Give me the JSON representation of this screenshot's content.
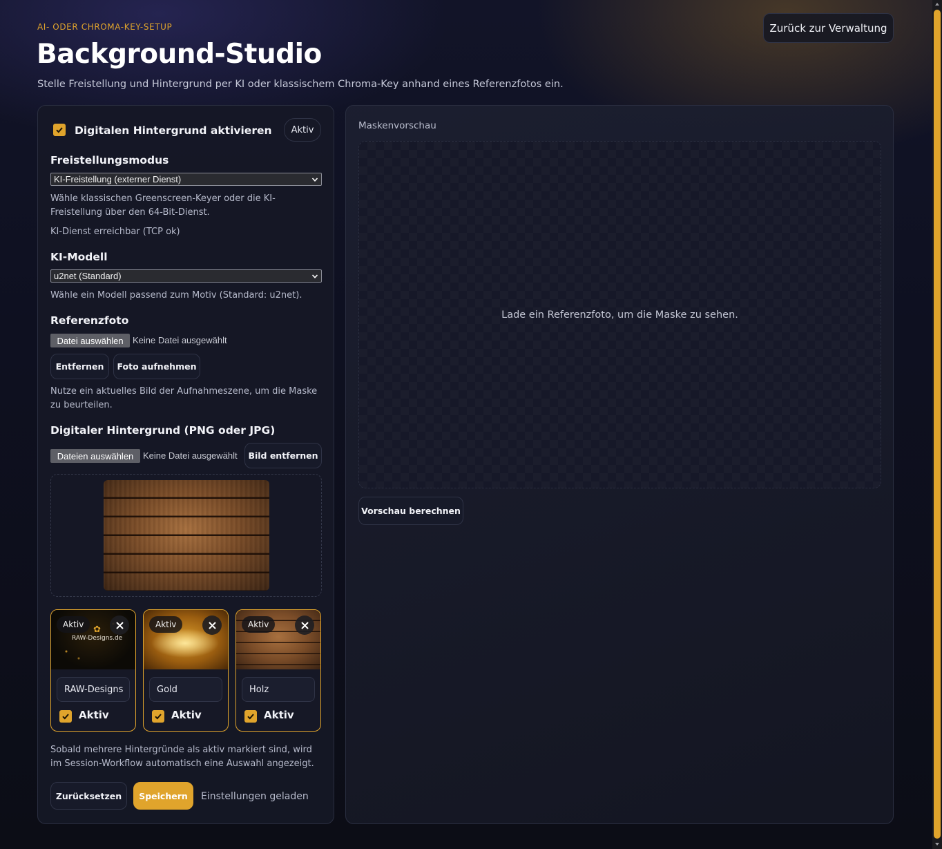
{
  "header": {
    "eyebrow": "AI- ODER CHROMA-KEY-SETUP",
    "title": "Background-Studio",
    "subtitle": "Stelle Freistellung und Hintergrund per KI oder klassischem Chroma-Key anhand eines Referenzfotos ein.",
    "back_button": "Zurück zur Verwaltung"
  },
  "left": {
    "enable_label": "Digitalen Hintergrund aktivieren",
    "enable_checked": true,
    "status_pill": "Aktiv",
    "mode": {
      "label": "Freistellungsmodus",
      "selected": "KI-Freistellung (externer Dienst)",
      "help": "Wähle klassischen Greenscreen-Keyer oder die KI-Freistellung über den 64-Bit-Dienst.",
      "status": "KI-Dienst erreichbar (TCP ok)"
    },
    "model": {
      "label": "KI-Modell",
      "selected": "u2net (Standard)",
      "help": "Wähle ein Modell passend zum Motiv (Standard: u2net)."
    },
    "reference": {
      "label": "Referenzfoto",
      "file_button": "Datei auswählen",
      "file_none": "Keine Datei ausgewählt",
      "remove_button": "Entfernen",
      "capture_button": "Foto aufnehmen",
      "help": "Nutze ein aktuelles Bild der Aufnahmeszene, um die Maske zu beurteilen."
    },
    "background": {
      "label": "Digitaler Hintergrund (PNG oder JPG)",
      "file_button": "Dateien auswählen",
      "file_none": "Keine Datei ausgewählt",
      "remove_button": "Bild entfernen"
    },
    "cards": [
      {
        "badge": "Aktiv",
        "name": "RAW-Designs",
        "aktiv_label": "Aktiv",
        "checked": true,
        "thumb": "raw-designs",
        "logo_text": "RAW-Designs.de"
      },
      {
        "badge": "Aktiv",
        "name": "Gold",
        "aktiv_label": "Aktiv",
        "checked": true,
        "thumb": "gold"
      },
      {
        "badge": "Aktiv",
        "name": "Holz",
        "aktiv_label": "Aktiv",
        "checked": true,
        "thumb": "wood"
      }
    ],
    "multi_help": "Sobald mehrere Hintergründe als aktiv markiert sind, wird im Session-Workflow automatisch eine Auswahl angezeigt.",
    "reset_button": "Zurücksetzen",
    "save_button": "Speichern",
    "save_status": "Einstellungen geladen"
  },
  "right": {
    "title": "Maskenvorschau",
    "placeholder": "Lade ein Referenzfoto, um die Maske zu sehen.",
    "compute_button": "Vorschau berechnen"
  },
  "colors": {
    "accent": "#e0a42c",
    "background": "#0e1020",
    "panel": "#161826"
  }
}
